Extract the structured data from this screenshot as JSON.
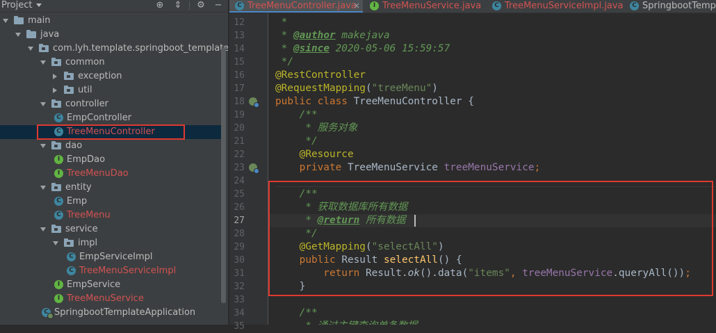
{
  "project_panel": {
    "title": "Project",
    "tree": [
      {
        "label": "main",
        "type": "folder",
        "expanded": true,
        "color": "normal"
      },
      {
        "label": "java",
        "type": "folder",
        "expanded": true,
        "color": "normal"
      },
      {
        "label": "com.lyh.template.springboot_template",
        "type": "package",
        "expanded": true,
        "color": "normal"
      },
      {
        "label": "common",
        "type": "package",
        "expanded": true,
        "color": "normal"
      },
      {
        "label": "exception",
        "type": "package",
        "expanded": false,
        "color": "normal"
      },
      {
        "label": "util",
        "type": "package",
        "expanded": false,
        "color": "normal"
      },
      {
        "label": "controller",
        "type": "package",
        "expanded": true,
        "color": "normal"
      },
      {
        "label": "EmpController",
        "type": "class",
        "color": "normal"
      },
      {
        "label": "TreeMenuController",
        "type": "class",
        "color": "red",
        "selected": true
      },
      {
        "label": "dao",
        "type": "package",
        "expanded": true,
        "color": "normal"
      },
      {
        "label": "EmpDao",
        "type": "interface",
        "color": "normal"
      },
      {
        "label": "TreeMenuDao",
        "type": "interface",
        "color": "red"
      },
      {
        "label": "entity",
        "type": "package",
        "expanded": true,
        "color": "normal"
      },
      {
        "label": "Emp",
        "type": "class",
        "color": "normal"
      },
      {
        "label": "TreeMenu",
        "type": "class",
        "color": "red"
      },
      {
        "label": "service",
        "type": "package",
        "expanded": true,
        "color": "normal"
      },
      {
        "label": "impl",
        "type": "package",
        "expanded": true,
        "color": "normal"
      },
      {
        "label": "EmpServiceImpl",
        "type": "class",
        "color": "normal"
      },
      {
        "label": "TreeMenuServiceImpl",
        "type": "class",
        "color": "red"
      },
      {
        "label": "EmpService",
        "type": "interface",
        "color": "normal"
      },
      {
        "label": "TreeMenuService",
        "type": "interface",
        "color": "red"
      },
      {
        "label": "SpringbootTemplateApplication",
        "type": "spring-class",
        "color": "normal"
      }
    ]
  },
  "tabs": [
    {
      "label": "TreeMenuController.java",
      "icon": "class-icon",
      "active": true,
      "color": "red",
      "closable": true
    },
    {
      "label": "TreeMenuService.java",
      "icon": "interface-icon",
      "active": false,
      "color": "red",
      "closable": false
    },
    {
      "label": "TreeMenuServiceImpl.java",
      "icon": "class-icon",
      "active": false,
      "color": "red",
      "closable": false
    },
    {
      "label": "SpringbootTempl",
      "icon": "spring-class-icon",
      "active": false,
      "color": "normal",
      "closable": false
    }
  ],
  "editor": {
    "current_line": "27",
    "gutter_icons": {
      "line_18": "spring-bean-icon",
      "line_23": "spring-inject-icon"
    },
    "lines": [
      {
        "num": "12",
        "tokens": [
          [
            "cm",
            " * "
          ]
        ]
      },
      {
        "num": "13",
        "tokens": [
          [
            "cm",
            " * "
          ],
          [
            "cmt",
            "@author"
          ],
          [
            "cm",
            " makejava"
          ]
        ]
      },
      {
        "num": "14",
        "tokens": [
          [
            "cm",
            " * "
          ],
          [
            "cmt",
            "@since"
          ],
          [
            "cm",
            " 2020-05-06 15:59:57"
          ]
        ]
      },
      {
        "num": "15",
        "tokens": [
          [
            "cm",
            " */"
          ]
        ]
      },
      {
        "num": "16",
        "tokens": [
          [
            "a",
            "@RestController"
          ]
        ]
      },
      {
        "num": "17",
        "tokens": [
          [
            "a",
            "@RequestMapping"
          ],
          [
            "tx",
            "("
          ],
          [
            "s",
            "\"treeMenu\""
          ],
          [
            "tx",
            ")"
          ]
        ]
      },
      {
        "num": "18",
        "tokens": [
          [
            "k",
            "public class "
          ],
          [
            "tx",
            "TreeMenuController {"
          ]
        ]
      },
      {
        "num": "19",
        "tokens": [
          [
            "cm",
            "    /**"
          ]
        ]
      },
      {
        "num": "20",
        "tokens": [
          [
            "cm",
            "     * 服务对象"
          ]
        ]
      },
      {
        "num": "21",
        "tokens": [
          [
            "cm",
            "     */"
          ]
        ]
      },
      {
        "num": "22",
        "tokens": [
          [
            "a",
            "    @Resource"
          ]
        ]
      },
      {
        "num": "23",
        "tokens": [
          [
            "k",
            "    private "
          ],
          [
            "tx",
            "TreeMenuService "
          ],
          [
            "f",
            "treeMenuService"
          ],
          [
            "k",
            ";"
          ]
        ]
      },
      {
        "num": "24",
        "tokens": [
          [
            "tx",
            ""
          ]
        ]
      },
      {
        "num": "25",
        "tokens": [
          [
            "cm",
            "    /**"
          ]
        ]
      },
      {
        "num": "26",
        "tokens": [
          [
            "cm",
            "     * 获取数据库所有数据"
          ]
        ]
      },
      {
        "num": "27",
        "tokens": [
          [
            "cm",
            "     * "
          ],
          [
            "cmt",
            "@return"
          ],
          [
            "cm",
            " 所有数据"
          ]
        ]
      },
      {
        "num": "28",
        "tokens": [
          [
            "cm",
            "     */"
          ]
        ]
      },
      {
        "num": "29",
        "tokens": [
          [
            "a",
            "    @GetMapping"
          ],
          [
            "tx",
            "("
          ],
          [
            "s",
            "\"selectAll\""
          ],
          [
            "tx",
            ")"
          ]
        ]
      },
      {
        "num": "30",
        "tokens": [
          [
            "k",
            "    public "
          ],
          [
            "tx",
            "Result "
          ],
          [
            "mi",
            "selectAll"
          ],
          [
            "tx",
            "() {"
          ]
        ]
      },
      {
        "num": "31",
        "tokens": [
          [
            "k",
            "        return "
          ],
          [
            "tx",
            "Result."
          ],
          [
            "st",
            "ok"
          ],
          [
            "tx",
            "().data("
          ],
          [
            "s",
            "\"items\""
          ],
          [
            "k",
            ", "
          ],
          [
            "f",
            "treeMenuService"
          ],
          [
            "tx",
            ".queryAll())"
          ],
          [
            "k",
            ";"
          ]
        ]
      },
      {
        "num": "32",
        "tokens": [
          [
            "tx",
            "    }"
          ]
        ]
      },
      {
        "num": "33",
        "tokens": [
          [
            "tx",
            ""
          ]
        ]
      },
      {
        "num": "34",
        "tokens": [
          [
            "cm",
            "    /**"
          ]
        ]
      },
      {
        "num": "35",
        "tokens": [
          [
            "cm",
            "     * 通过主键查询单条数据"
          ]
        ]
      }
    ]
  },
  "colors": {
    "highlight_box": "#e0392f",
    "red_file": "#d25252",
    "accent_tab": "#4a88c7"
  }
}
